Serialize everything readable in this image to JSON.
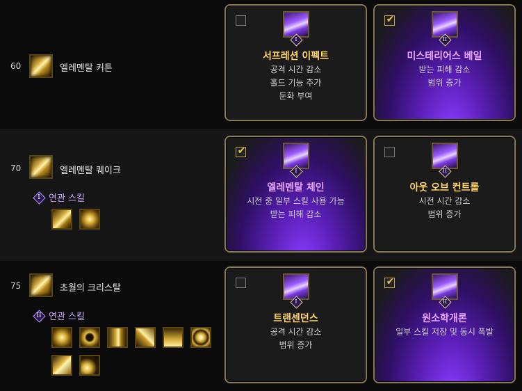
{
  "rows": [
    {
      "level": "60",
      "skill_name": "엘레멘탈 커튼",
      "skill_icon": "elemental-curtain-icon",
      "cards": [
        {
          "title": "서프레션 이펙트",
          "badge": "I",
          "checked": false,
          "lines": [
            "공격 시간 감소",
            "홀드 기능 추가",
            "둔화 부여"
          ]
        },
        {
          "title": "미스테리어스 베일",
          "badge": "II",
          "checked": true,
          "lines": [
            "받는 피해 감소",
            "범위 증가"
          ]
        }
      ]
    },
    {
      "level": "70",
      "skill_name": "엘레멘탈 퀘이크",
      "skill_icon": "elemental-quake-icon",
      "related_label": "연관 스킬",
      "related_badge": "I",
      "cards": [
        {
          "title": "엘레멘탈 체인",
          "badge": "I",
          "checked": true,
          "lines": [
            "시전 중 일부 스킬 사용 가능",
            "받는 피해 감소"
          ]
        },
        {
          "title": "아웃 오브 컨트롤",
          "badge": "II",
          "checked": false,
          "lines": [
            "시전 시간 감소",
            "범위 증가"
          ]
        }
      ]
    },
    {
      "level": "75",
      "skill_name": "초월의 크리스탈",
      "skill_icon": "transcendent-crystal-icon",
      "related_label": "연관 스킬",
      "related_badge": "II",
      "cards": [
        {
          "title": "트랜센던스",
          "badge": "I",
          "checked": false,
          "lines": [
            "공격 시간 감소",
            "범위 증가"
          ]
        },
        {
          "title": "원소학개론",
          "badge": "II",
          "checked": true,
          "lines": [
            "일부 스킬 저장 및 동시 폭발"
          ]
        }
      ]
    }
  ]
}
